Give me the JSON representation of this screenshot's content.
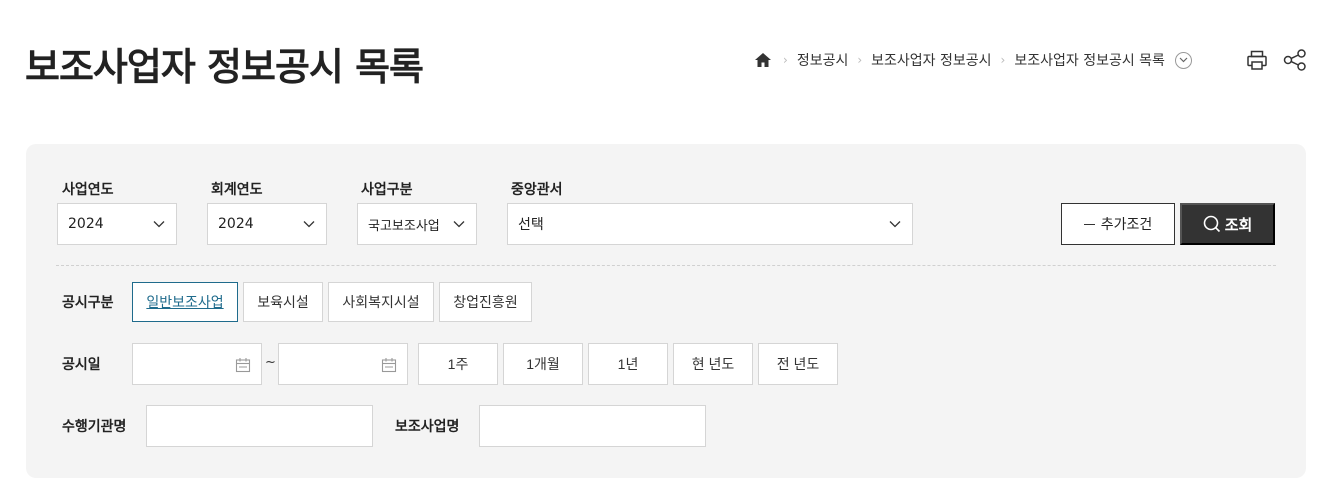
{
  "page": {
    "title": "보조사업자 정보공시 목록"
  },
  "breadcrumb": {
    "home_icon": "home-icon",
    "items": [
      "정보공시",
      "보조사업자 정보공시",
      "보조사업자 정보공시 목록"
    ]
  },
  "tools": {
    "print_icon": "print-icon",
    "share_icon": "share-icon"
  },
  "filters": {
    "business_year": {
      "label": "사업연도",
      "value": "2024"
    },
    "fiscal_year": {
      "label": "회계연도",
      "value": "2024"
    },
    "business_type": {
      "label": "사업구분",
      "value": "국고보조사업"
    },
    "ministry": {
      "label": "중앙관서",
      "value": "선택"
    },
    "more_label": "추가조건",
    "search_label": "조회"
  },
  "disclosure_type": {
    "label": "공시구분",
    "options": [
      "일반보조사업",
      "보육시설",
      "사회복지시설",
      "창업진흥원"
    ],
    "selected": "일반보조사업"
  },
  "disclosure_date": {
    "label": "공시일",
    "separator": "~",
    "periods": [
      "1주",
      "1개월",
      "1년",
      "현 년도",
      "전 년도"
    ]
  },
  "agency": {
    "label": "수행기관명"
  },
  "project": {
    "label": "보조사업명"
  },
  "colors": {
    "accent": "#1f6b8c",
    "dark_button": "#333333",
    "panel_bg": "#f4f4f4"
  }
}
